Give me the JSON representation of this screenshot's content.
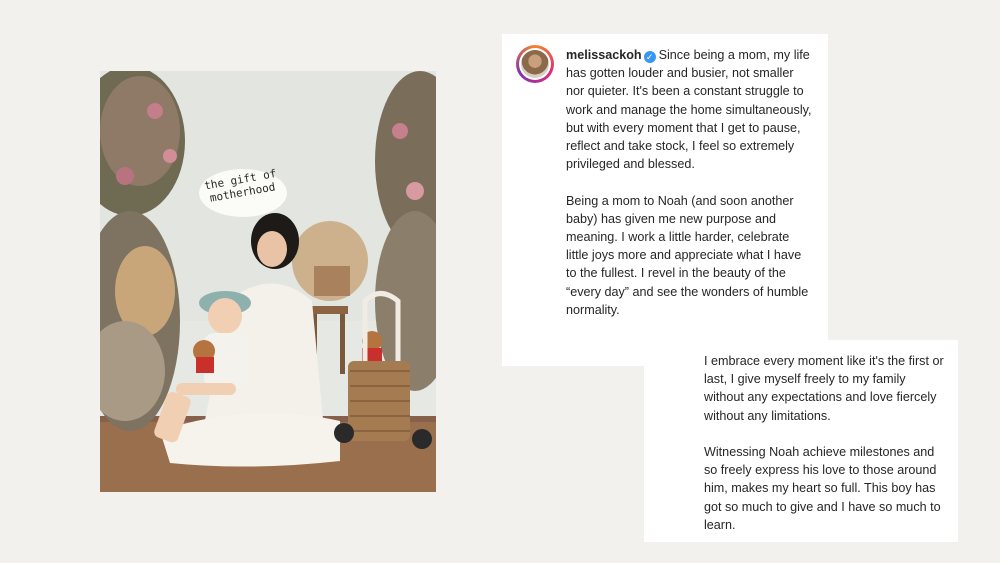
{
  "photo": {
    "sticker_text": "the gift of motherhood"
  },
  "post": {
    "username": "melissackoh",
    "verified_icon": "verified-badge-icon",
    "caption_part1": "Since being a mom, my life has gotten louder and busier, not smaller nor quieter. It's been a constant struggle to work and manage the home simultaneously, but with every moment that I get to pause, reflect and take stock, I feel so extremely privileged and blessed.\n\nBeing a mom to Noah (and soon another baby) has given me new purpose and meaning. I work a little harder, celebrate little joys more and appreciate what I have to the fullest. I revel in the beauty of the “every day” and see the wonders of humble normality.",
    "caption_part2": "I embrace every moment like it's the first or last, I give myself freely to my family without any expectations and love fiercely without any limitations.\n\nWitnessing Noah achieve milestones and so freely express his love to those around him, makes my heart so full. This boy has got so much to give and I have so much to learn."
  },
  "colors": {
    "background": "#f3f1ee",
    "card": "#ffffff",
    "text": "#262626",
    "verified": "#3897f0"
  }
}
